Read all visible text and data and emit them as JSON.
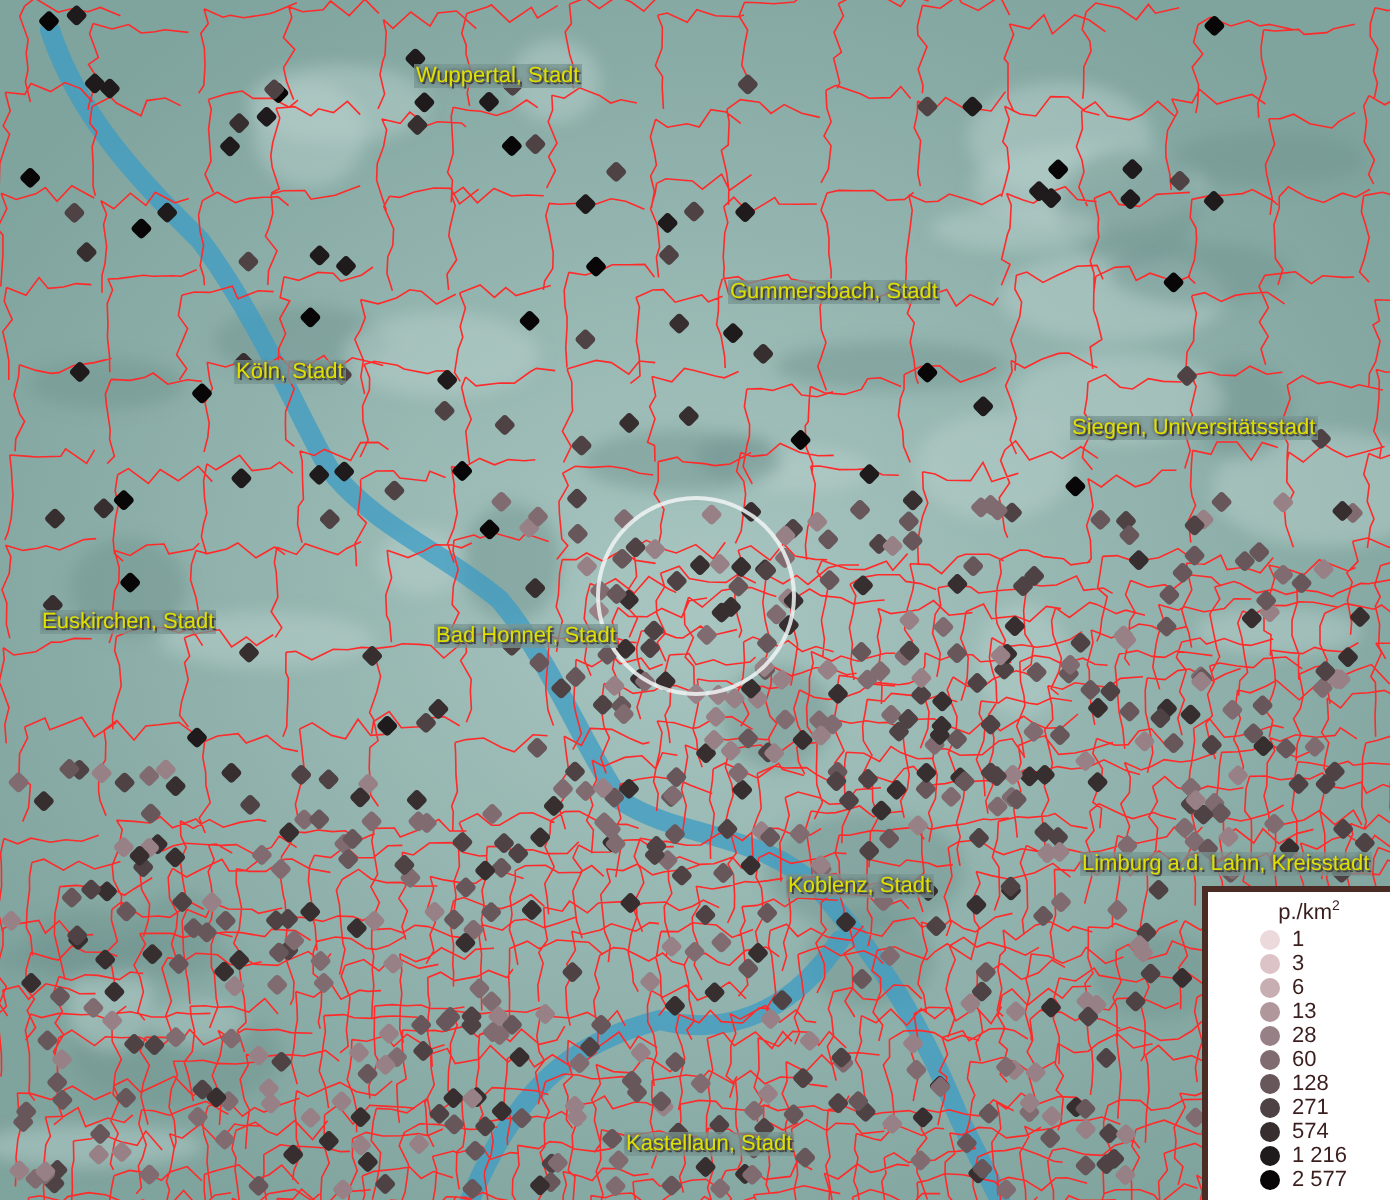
{
  "map": {
    "places": [
      {
        "name": "Wuppertal, Stadt"
      },
      {
        "name": "Gummersbach, Stadt"
      },
      {
        "name": "Köln, Stadt"
      },
      {
        "name": "Siegen, Universitätsstadt"
      },
      {
        "name": "Euskirchen, Stadt"
      },
      {
        "name": "Bad Honnef, Stadt"
      },
      {
        "name": "Limburg a.d. Lahn, Kreisstadt"
      },
      {
        "name": "Koblenz, Stadt"
      },
      {
        "name": "Kastellaun, Stadt"
      }
    ]
  },
  "legend": {
    "title": "p./km$^{2}$",
    "items": [
      {
        "label": "1",
        "color": "#ecd9dc"
      },
      {
        "label": "3",
        "color": "#dbc3c7"
      },
      {
        "label": "6",
        "color": "#c7aeb2"
      },
      {
        "label": "13",
        "color": "#b0979c"
      },
      {
        "label": "28",
        "color": "#988186"
      },
      {
        "label": "60",
        "color": "#806c70"
      },
      {
        "label": "128",
        "color": "#67575a"
      },
      {
        "label": "271",
        "color": "#4f4245"
      },
      {
        "label": "574",
        "color": "#372e30"
      },
      {
        "label": "1 216",
        "color": "#1f1a1b"
      },
      {
        "label": "2 577",
        "color": "#080606"
      }
    ]
  }
}
